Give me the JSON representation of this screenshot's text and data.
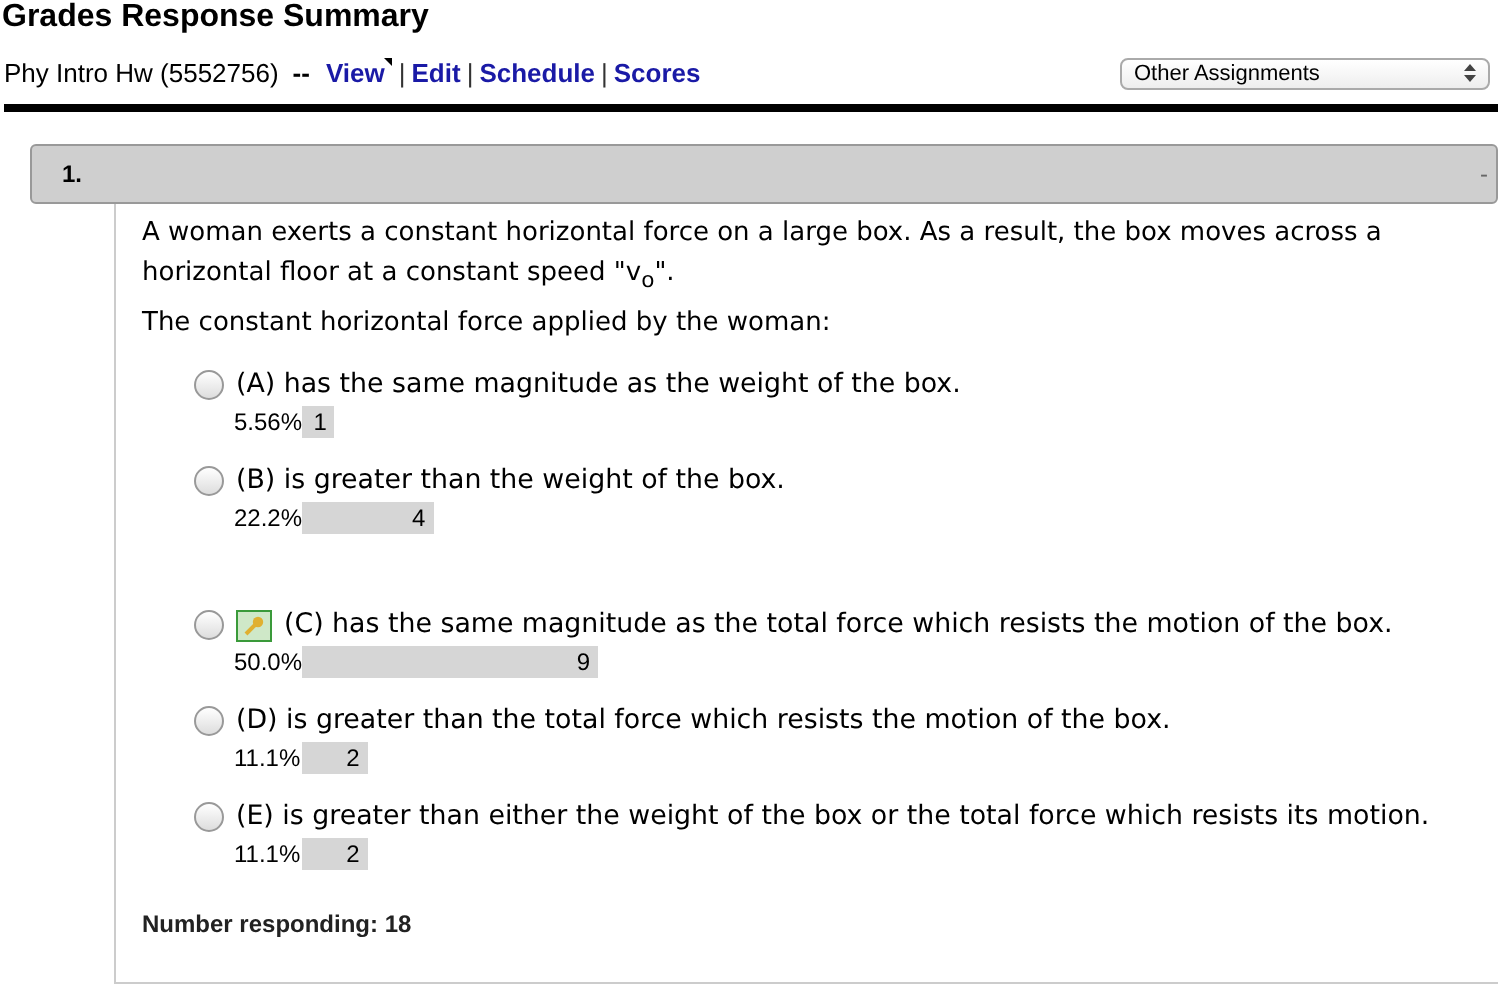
{
  "page_title": "Grades Response Summary",
  "assignment": {
    "name": "Phy Intro Hw (5552756)",
    "separator": "--",
    "divider": "|",
    "links": [
      {
        "label": "View",
        "marked": true
      },
      {
        "label": "Edit",
        "marked": false
      },
      {
        "label": "Schedule",
        "marked": false
      },
      {
        "label": "Scores",
        "marked": false
      }
    ]
  },
  "assignment_select": {
    "value": "Other Assignments"
  },
  "question": {
    "number": "1.",
    "collapse": "-",
    "prompt": "A woman exerts a constant horizontal force on a large box. As a result, the box moves across a horizontal floor at a constant speed \"v$_{o}$\".",
    "stem": "The constant horizontal force applied by the woman:",
    "options": [
      {
        "text": "(A) has the same magnitude as the weight of the box.",
        "selected": false,
        "correct": false,
        "percent": "5.56%",
        "count": "1"
      },
      {
        "text": "(B) is greater than the weight of the box.",
        "selected": false,
        "correct": false,
        "percent": "22.2%",
        "count": "4"
      },
      {
        "text": "(C) has the same magnitude as the total force which resists the motion of the box.",
        "selected": false,
        "correct": true,
        "percent": "50.0%",
        "count": "9"
      },
      {
        "text": "(D) is greater than the total force which resists the motion of the box.",
        "selected": false,
        "correct": false,
        "percent": "11.1%",
        "count": "2"
      },
      {
        "text": "(E) is greater than either the weight of the box or the total force which resists its motion.",
        "selected": false,
        "correct": false,
        "percent": "11.1%",
        "count": "2"
      }
    ],
    "responding": "Number responding: 18"
  }
}
